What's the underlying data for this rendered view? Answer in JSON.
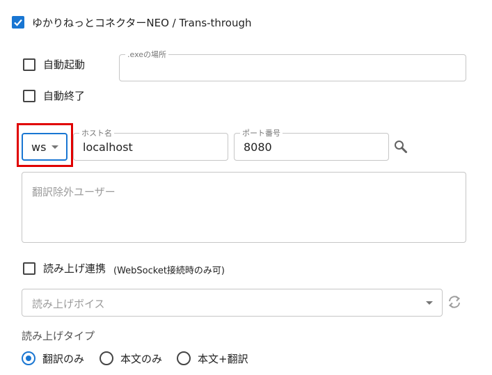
{
  "header": {
    "enable_label": "ゆかりねっとコネクターNEO / Trans-through",
    "enabled": true
  },
  "auto_start": {
    "label": "自動起動",
    "checked": false
  },
  "auto_exit": {
    "label": "自動終了",
    "checked": false
  },
  "exe_path": {
    "legend": ".exeの場所",
    "value": ""
  },
  "connection": {
    "protocol": "ws",
    "host_legend": "ホスト名",
    "host_value": "localhost",
    "port_legend": "ポート番号",
    "port_value": "8080"
  },
  "exclude_users": {
    "placeholder": "翻訳除外ユーザー",
    "value": ""
  },
  "read_aloud": {
    "label": "読み上げ連携",
    "note": "(WebSocket接続時のみ可)",
    "checked": false
  },
  "voice_select": {
    "placeholder": "読み上げボイス"
  },
  "read_type": {
    "heading": "読み上げタイプ",
    "options": [
      {
        "label": "翻訳のみ",
        "selected": true
      },
      {
        "label": "本文のみ",
        "selected": false
      },
      {
        "label": "本文+翻訳",
        "selected": false
      }
    ]
  },
  "icons": {
    "search": "search-icon",
    "refresh": "refresh-icon",
    "dropdown": "chevron-down-icon",
    "check": "check-icon"
  },
  "colors": {
    "accent": "#1976d2",
    "highlight": "#e00000",
    "border": "#c6c6c6"
  }
}
